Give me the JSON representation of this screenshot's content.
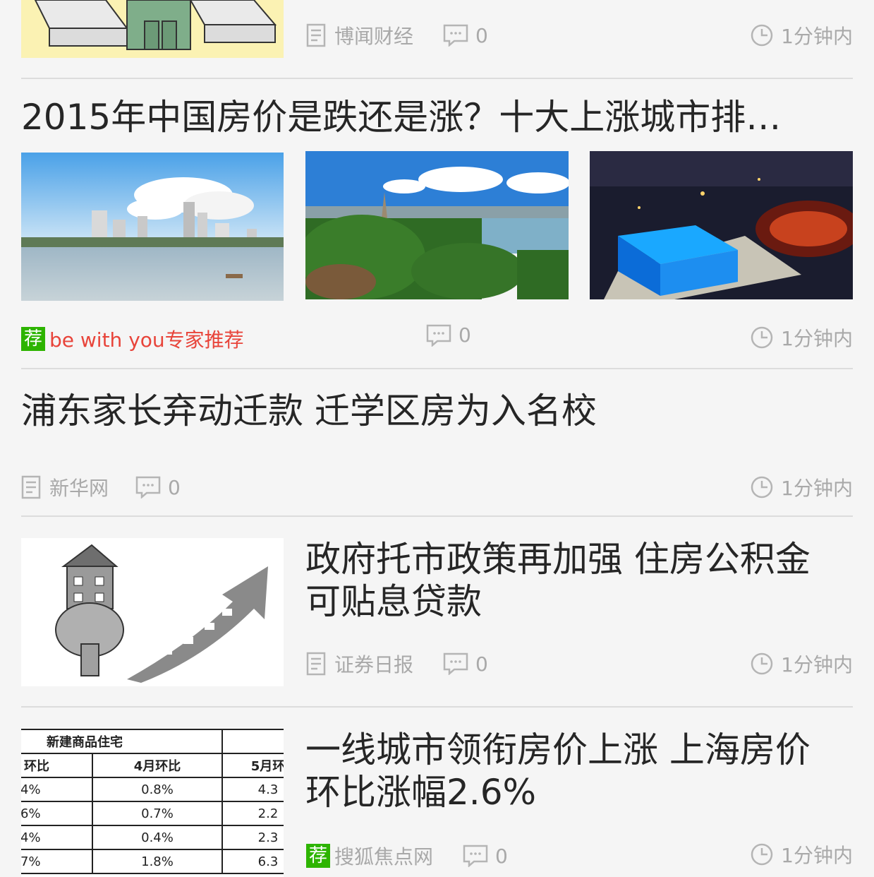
{
  "articles": [
    {
      "source": "博闻财经",
      "comments": "0",
      "time": "1分钟内"
    },
    {
      "title": "2015年中国房价是跌还是涨？十大上涨城市排…",
      "recommend_badge": "荐",
      "source": "be with you专家推荐",
      "comments": "0",
      "time": "1分钟内"
    },
    {
      "title": "浦东家长弃动迁款 迁学区房为入名校",
      "source": "新华网",
      "comments": "0",
      "time": "1分钟内"
    },
    {
      "title_line1": "政府托市政策再加强 住房公积金",
      "title_line2": "可贴息贷款",
      "source": "证券日报",
      "comments": "0",
      "time": "1分钟内"
    },
    {
      "title_line1": "一线城市领衔房价上涨 上海房价",
      "title_line2": "环比涨幅2.6%",
      "recommend_badge": "荐",
      "source": "搜狐焦点网",
      "comments": "0",
      "time": "1分钟内",
      "table": {
        "header": "新建商品住宅",
        "cols": [
          "环比",
          "4月环比",
          "5月环"
        ],
        "rows": [
          [
            "4%",
            "0.8%",
            "4.3"
          ],
          [
            "6%",
            "0.7%",
            "2.2"
          ],
          [
            "4%",
            "0.4%",
            "2.3"
          ],
          [
            "7%",
            "1.8%",
            "6.3"
          ]
        ]
      }
    }
  ],
  "colors": {
    "recommend": "#2db400",
    "recommend_text": "#e8443a",
    "meta": "#a9a9a9"
  }
}
